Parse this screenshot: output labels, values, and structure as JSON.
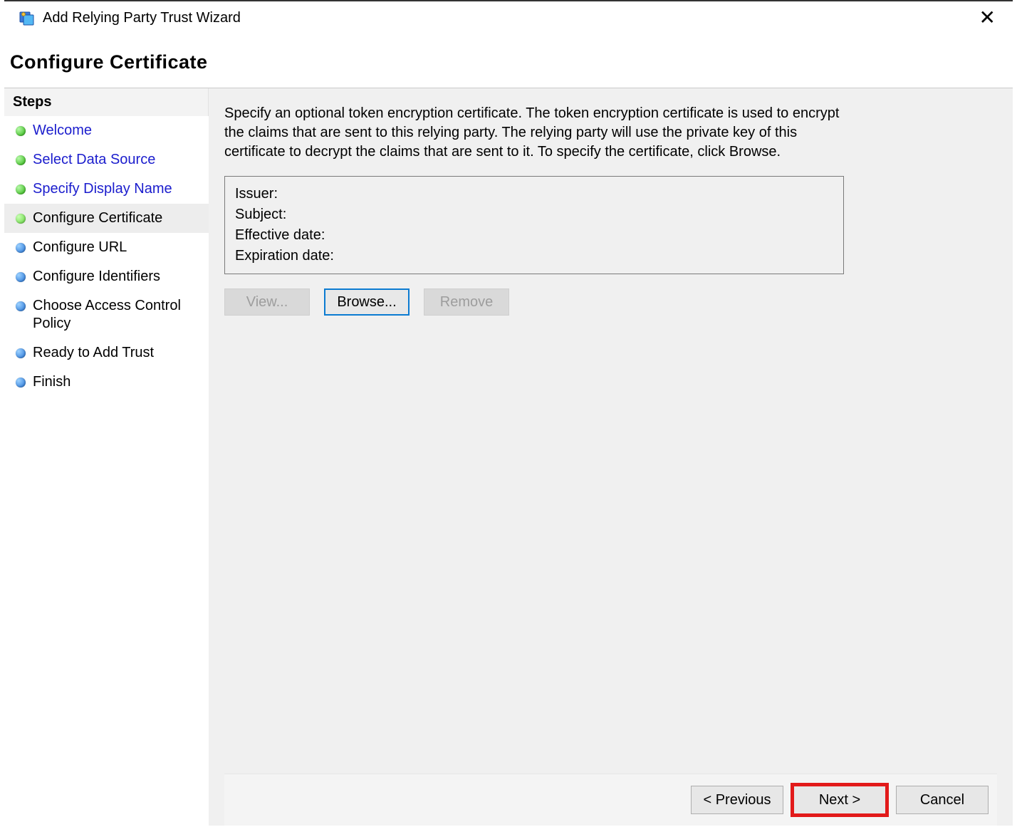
{
  "window": {
    "title": "Add Relying Party Trust Wizard"
  },
  "page": {
    "heading": "Configure Certificate"
  },
  "sidebar": {
    "header": "Steps",
    "items": [
      {
        "label": "Welcome",
        "state": "past",
        "bullet": "green"
      },
      {
        "label": "Select Data Source",
        "state": "past",
        "bullet": "green"
      },
      {
        "label": "Specify Display Name",
        "state": "past",
        "bullet": "green"
      },
      {
        "label": "Configure Certificate",
        "state": "current",
        "bullet": "lime"
      },
      {
        "label": "Configure URL",
        "state": "future",
        "bullet": "blue"
      },
      {
        "label": "Configure Identifiers",
        "state": "future",
        "bullet": "blue"
      },
      {
        "label": "Choose Access Control Policy",
        "state": "future",
        "bullet": "blue"
      },
      {
        "label": "Ready to Add Trust",
        "state": "future",
        "bullet": "blue"
      },
      {
        "label": "Finish",
        "state": "future",
        "bullet": "blue"
      }
    ]
  },
  "main": {
    "instruction": "Specify an optional token encryption certificate.  The token encryption certificate is used to encrypt the claims that are sent to this relying party.  The relying party will use the private key of this certificate to decrypt the claims that are sent to it.  To specify the certificate, click Browse.",
    "cert": {
      "issuer_label": "Issuer:",
      "issuer_value": "",
      "subject_label": "Subject:",
      "subject_value": "",
      "effective_label": "Effective date:",
      "effective_value": "",
      "expiration_label": "Expiration date:",
      "expiration_value": ""
    },
    "buttons": {
      "view": "View...",
      "browse": "Browse...",
      "remove": "Remove"
    }
  },
  "footer": {
    "previous": "< Previous",
    "next": "Next >",
    "cancel": "Cancel"
  }
}
